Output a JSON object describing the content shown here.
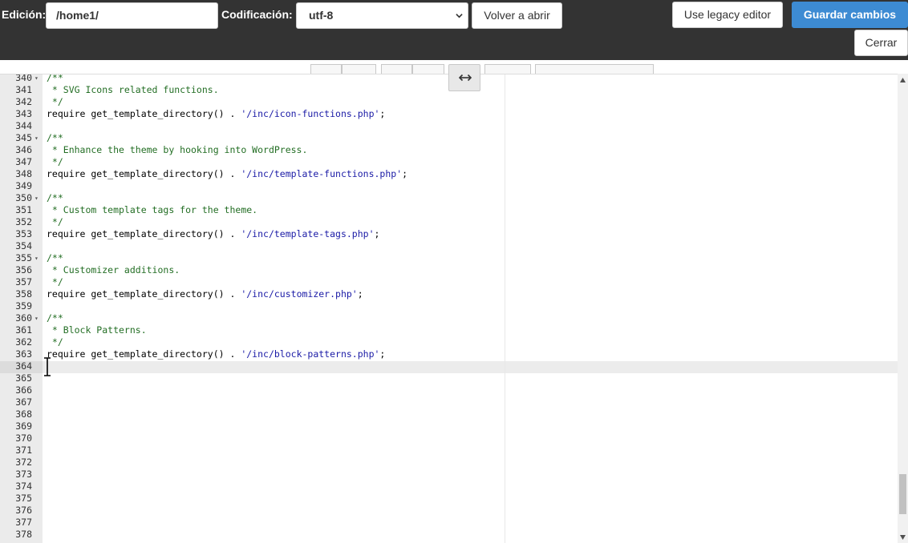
{
  "toolbar": {
    "edit_label": "Edición:",
    "path_value": "/home1/",
    "encoding_label": "Codificación:",
    "encoding_value": "utf-8",
    "reopen_label": "Volver a abrir",
    "legacy_label": "Use legacy editor",
    "save_label": "Guardar cambios",
    "close_label": "Cerrar"
  },
  "colors": {
    "topbar": "#333333",
    "primary": "#3d8bd3",
    "comment": "#236e24",
    "string": "#1a1aa6"
  },
  "editor": {
    "lines": [
      {
        "n": "340",
        "fold": "▾",
        "segs": [
          {
            "t": "/**",
            "c": "comment"
          }
        ]
      },
      {
        "n": "341",
        "fold": "",
        "segs": [
          {
            "t": " * SVG Icons related functions.",
            "c": "comment"
          }
        ]
      },
      {
        "n": "342",
        "fold": "",
        "segs": [
          {
            "t": " */",
            "c": "comment"
          }
        ]
      },
      {
        "n": "343",
        "fold": "",
        "segs": [
          {
            "t": "require get_template_directory() . ",
            "c": "keyword"
          },
          {
            "t": "'/inc/icon-functions.php'",
            "c": "string"
          },
          {
            "t": ";",
            "c": "keyword"
          }
        ]
      },
      {
        "n": "344",
        "fold": "",
        "segs": []
      },
      {
        "n": "345",
        "fold": "▾",
        "segs": [
          {
            "t": "/**",
            "c": "comment"
          }
        ]
      },
      {
        "n": "346",
        "fold": "",
        "segs": [
          {
            "t": " * Enhance the theme by hooking into WordPress.",
            "c": "comment"
          }
        ]
      },
      {
        "n": "347",
        "fold": "",
        "segs": [
          {
            "t": " */",
            "c": "comment"
          }
        ]
      },
      {
        "n": "348",
        "fold": "",
        "segs": [
          {
            "t": "require get_template_directory() . ",
            "c": "keyword"
          },
          {
            "t": "'/inc/template-functions.php'",
            "c": "string"
          },
          {
            "t": ";",
            "c": "keyword"
          }
        ]
      },
      {
        "n": "349",
        "fold": "",
        "segs": []
      },
      {
        "n": "350",
        "fold": "▾",
        "segs": [
          {
            "t": "/**",
            "c": "comment"
          }
        ]
      },
      {
        "n": "351",
        "fold": "",
        "segs": [
          {
            "t": " * Custom template tags for the theme.",
            "c": "comment"
          }
        ]
      },
      {
        "n": "352",
        "fold": "",
        "segs": [
          {
            "t": " */",
            "c": "comment"
          }
        ]
      },
      {
        "n": "353",
        "fold": "",
        "segs": [
          {
            "t": "require get_template_directory() . ",
            "c": "keyword"
          },
          {
            "t": "'/inc/template-tags.php'",
            "c": "string"
          },
          {
            "t": ";",
            "c": "keyword"
          }
        ]
      },
      {
        "n": "354",
        "fold": "",
        "segs": []
      },
      {
        "n": "355",
        "fold": "▾",
        "segs": [
          {
            "t": "/**",
            "c": "comment"
          }
        ]
      },
      {
        "n": "356",
        "fold": "",
        "segs": [
          {
            "t": " * Customizer additions.",
            "c": "comment"
          }
        ]
      },
      {
        "n": "357",
        "fold": "",
        "segs": [
          {
            "t": " */",
            "c": "comment"
          }
        ]
      },
      {
        "n": "358",
        "fold": "",
        "segs": [
          {
            "t": "require get_template_directory() . ",
            "c": "keyword"
          },
          {
            "t": "'/inc/customizer.php'",
            "c": "string"
          },
          {
            "t": ";",
            "c": "keyword"
          }
        ]
      },
      {
        "n": "359",
        "fold": "",
        "segs": []
      },
      {
        "n": "360",
        "fold": "▾",
        "segs": [
          {
            "t": "/**",
            "c": "comment"
          }
        ]
      },
      {
        "n": "361",
        "fold": "",
        "segs": [
          {
            "t": " * Block Patterns.",
            "c": "comment"
          }
        ]
      },
      {
        "n": "362",
        "fold": "",
        "segs": [
          {
            "t": " */",
            "c": "comment"
          }
        ]
      },
      {
        "n": "363",
        "fold": "",
        "segs": [
          {
            "t": "require get_template_directory() . ",
            "c": "keyword"
          },
          {
            "t": "'/inc/block-patterns.php'",
            "c": "string"
          },
          {
            "t": ";",
            "c": "keyword"
          }
        ]
      },
      {
        "n": "364",
        "fold": "",
        "segs": []
      },
      {
        "n": "365",
        "fold": "",
        "segs": []
      },
      {
        "n": "366",
        "fold": "",
        "segs": []
      },
      {
        "n": "367",
        "fold": "",
        "segs": []
      },
      {
        "n": "368",
        "fold": "",
        "segs": []
      },
      {
        "n": "369",
        "fold": "",
        "segs": []
      },
      {
        "n": "370",
        "fold": "",
        "segs": []
      },
      {
        "n": "371",
        "fold": "",
        "segs": []
      },
      {
        "n": "372",
        "fold": "",
        "segs": []
      },
      {
        "n": "373",
        "fold": "",
        "segs": []
      },
      {
        "n": "374",
        "fold": "",
        "segs": []
      },
      {
        "n": "375",
        "fold": "",
        "segs": []
      },
      {
        "n": "376",
        "fold": "",
        "segs": []
      },
      {
        "n": "377",
        "fold": "",
        "segs": []
      },
      {
        "n": "378",
        "fold": "",
        "segs": []
      }
    ]
  }
}
